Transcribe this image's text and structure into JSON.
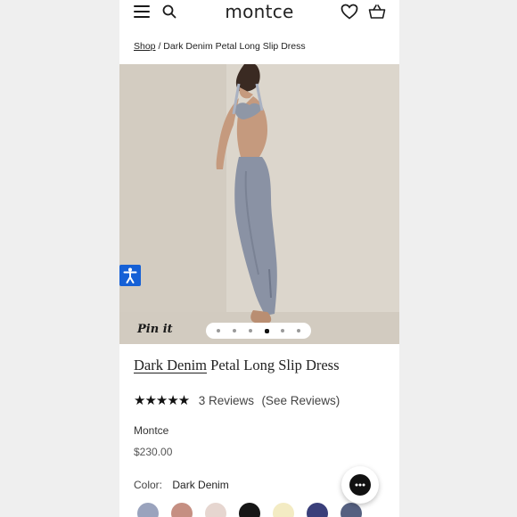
{
  "header": {
    "logo": "montce",
    "icons": [
      "menu-icon",
      "search-icon",
      "heart-icon",
      "basket-icon"
    ]
  },
  "breadcrumb": {
    "shop": "Shop",
    "separator": "/",
    "current": "Dark Denim Petal Long Slip Dress"
  },
  "gallery": {
    "pin_label": "Pin it",
    "dot_count": 6,
    "active_dot": 4
  },
  "product": {
    "title_prefix": "Dark Denim",
    "title_rest": "Petal Long Slip Dress",
    "rating": 5,
    "stars": "★★★★★",
    "reviews": "3 Reviews",
    "see_reviews": "(See Reviews)",
    "vendor": "Montce",
    "price": "$230.00",
    "color_label": "Color:",
    "color_value": "Dark Denim"
  },
  "swatches": [
    "#9aa3bd",
    "#c58f82",
    "#e6d6d0",
    "#161616",
    "#f3ebc3",
    "#3a3f7a",
    "#556080"
  ],
  "colors": {
    "page_bg": "#efefef",
    "hero_bg": "#d9d2c8",
    "accessibility_blue": "#1560d6"
  }
}
